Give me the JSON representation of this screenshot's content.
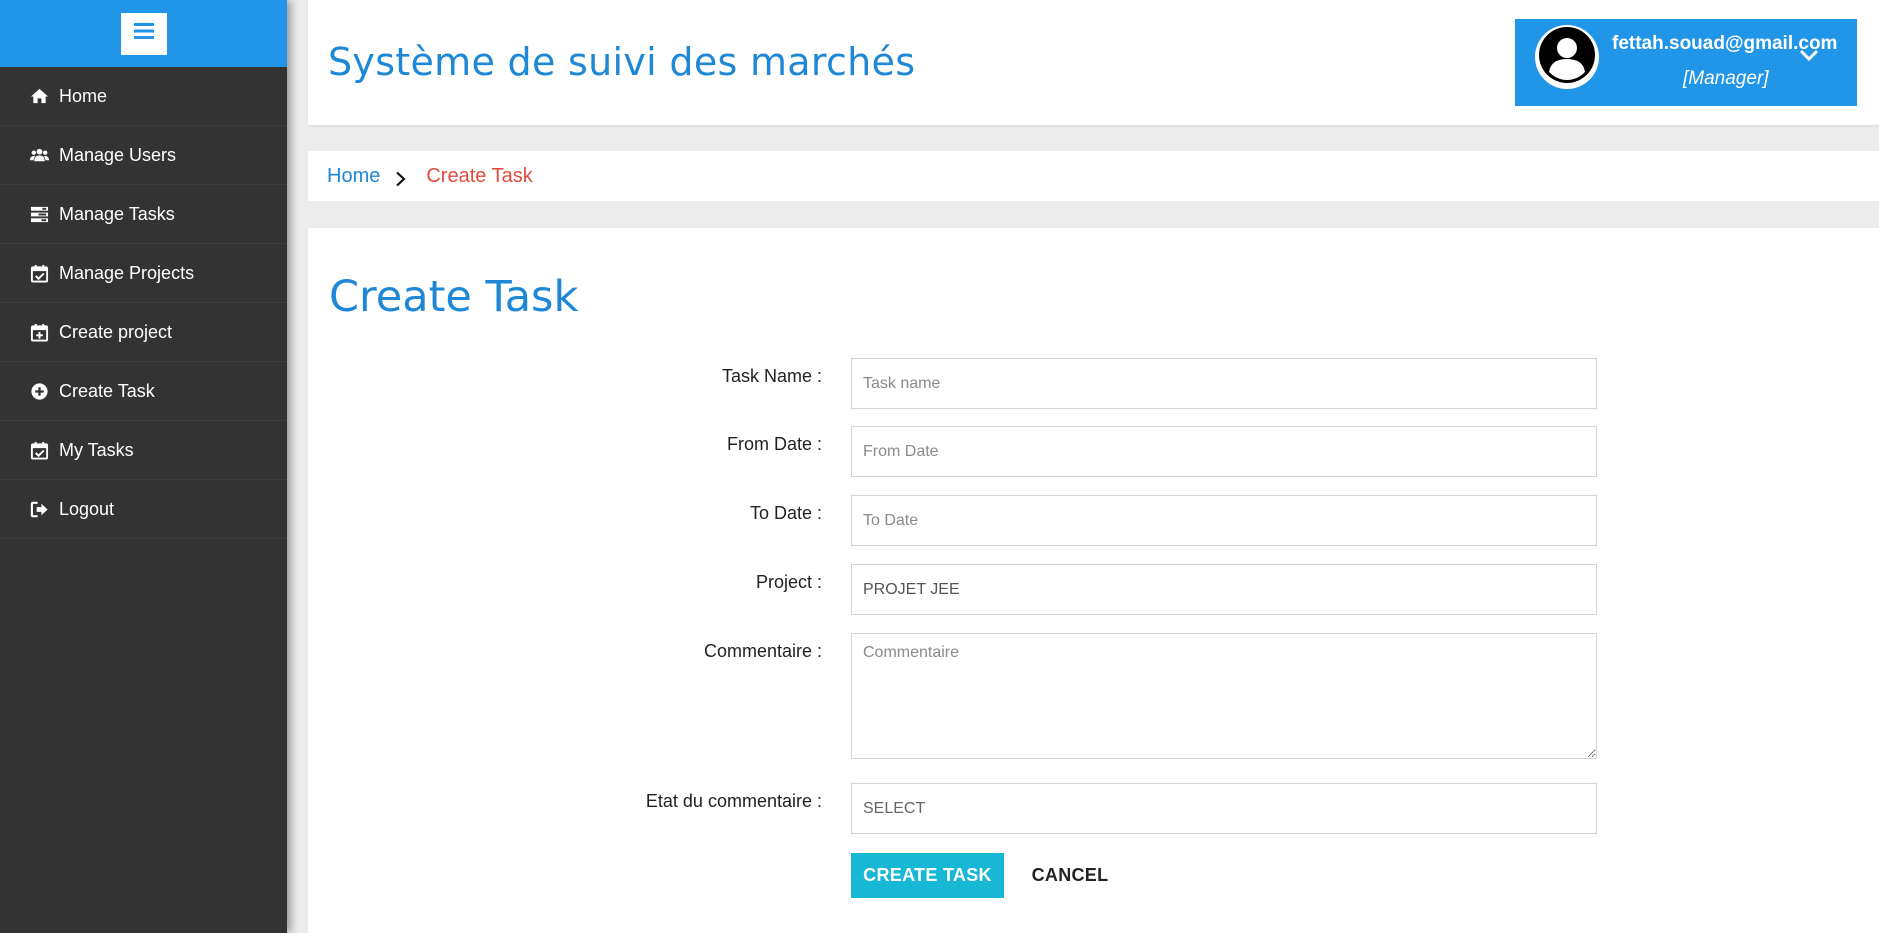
{
  "sidebar": {
    "items": [
      {
        "label": "Home",
        "icon": "home-icon"
      },
      {
        "label": "Manage Users",
        "icon": "users-icon"
      },
      {
        "label": "Manage Tasks",
        "icon": "tasks-icon"
      },
      {
        "label": "Manage Projects",
        "icon": "calendar-check-icon"
      },
      {
        "label": "Create project",
        "icon": "calendar-plus-icon"
      },
      {
        "label": "Create Task",
        "icon": "plus-circle-icon"
      },
      {
        "label": "My Tasks",
        "icon": "calendar-check-icon"
      },
      {
        "label": "Logout",
        "icon": "sign-out-icon"
      }
    ]
  },
  "header": {
    "title": "Système de suivi des marchés",
    "user": {
      "email": "fettah.souad@gmail.com",
      "role": "[Manager]"
    }
  },
  "breadcrumb": {
    "home": "Home",
    "current": "Create Task"
  },
  "main": {
    "title": "Create Task",
    "form": {
      "task_name": {
        "label": "Task Name :",
        "placeholder": "Task name"
      },
      "from_date": {
        "label": "From Date :",
        "placeholder": "From Date"
      },
      "to_date": {
        "label": "To Date :",
        "placeholder": "To Date"
      },
      "project": {
        "label": "Project :",
        "value": "PROJET JEE"
      },
      "commentaire": {
        "label": "Commentaire :",
        "placeholder": "Commentaire"
      },
      "etat": {
        "label": "Etat du commentaire :",
        "value": "SELECT"
      }
    },
    "create_label": "CREATE TASK",
    "cancel_label": "CANCEL"
  },
  "colors": {
    "accent": "#2196e8",
    "title_blue": "#1e88d6",
    "sidebar_bg": "#333333",
    "breadcrumb_active": "#e04b3f",
    "button_cyan": "#17b7d6"
  }
}
